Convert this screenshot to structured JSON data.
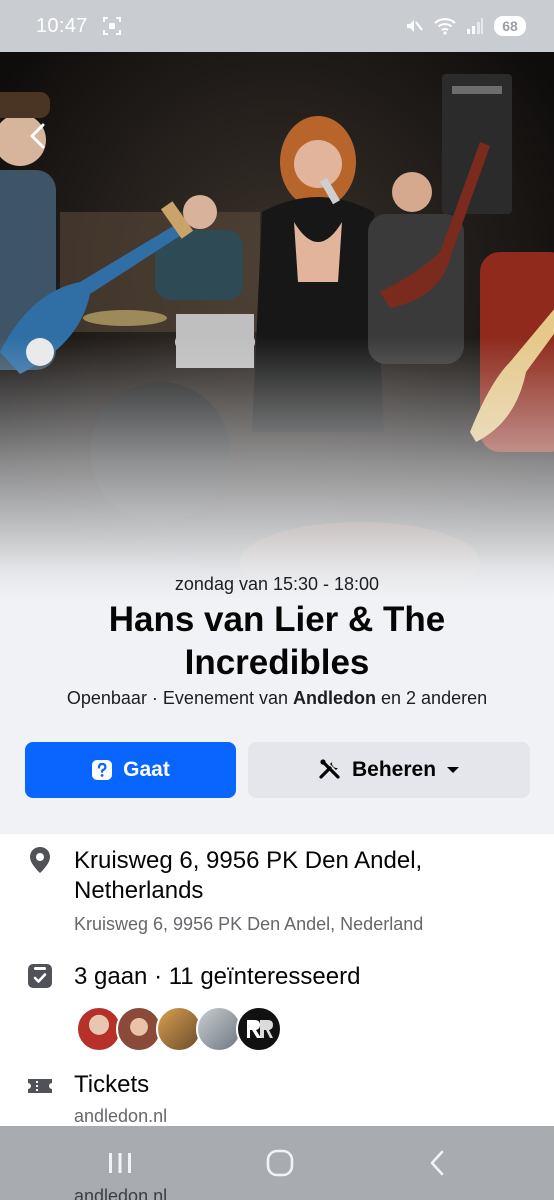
{
  "status_bar": {
    "time": "10:47",
    "battery": "68"
  },
  "event": {
    "date_time": "zondag van 15:30 - 18:00",
    "title": "Hans van Lier & The Incredibles",
    "meta_prefix": "Openbaar · Evenement van ",
    "meta_host": "Andledon",
    "meta_suffix": " en 2 anderen"
  },
  "actions": {
    "going_label": "Gaat",
    "manage_label": "Beheren"
  },
  "details": {
    "address_line": "Kruisweg 6, 9956 PK Den Andel,",
    "address_line2": "Netherlands",
    "address_sub": "Kruisweg 6, 9956 PK Den Andel, Nederland",
    "attendance": "3 gaan · 11 geïnteresseerd",
    "tickets_label": "Tickets",
    "tickets_link": "andledon.nl",
    "tickets_peek": "andledon.nl"
  },
  "icons": {
    "back": "chevron-left-icon",
    "location": "map-pin-icon",
    "attendance": "calendar-check-icon",
    "tickets": "ticket-icon"
  },
  "colors": {
    "primary": "#0866ff",
    "secondary_btn": "#e4e6eb",
    "section_bg": "#f0f2f5",
    "muted_text": "#65676b"
  }
}
